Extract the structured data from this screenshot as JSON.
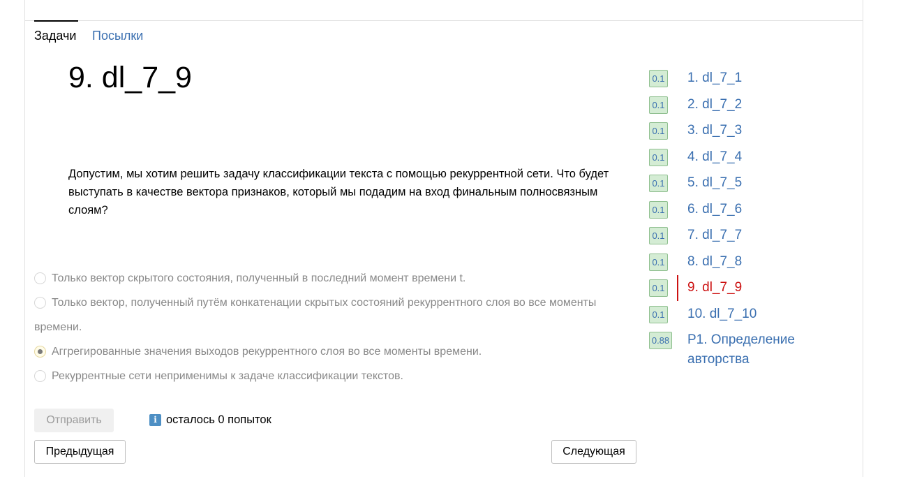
{
  "tabs": {
    "tasks": "Задачи",
    "submissions": "Посылки"
  },
  "task": {
    "title": "9. dl_7_9",
    "statement": "Допустим, мы хотим решить задачу классификации текста с помощью рекуррентной сети. Что будет выступать в качестве вектора признаков, который мы подадим на вход финальным полносвязным слоям?"
  },
  "options": [
    {
      "label": "Только вектор скрытого состояния, полученный в последний момент времени t.",
      "checked": false
    },
    {
      "label": "Только вектор, полученный путём конкатенации скрытых состояний рекуррентного слоя во все моменты",
      "label_cont": "времени.",
      "checked": false
    },
    {
      "label": "Аггрегированные значения выходов рекуррентного слоя во все моменты времени.",
      "checked": true
    },
    {
      "label": "Рекуррентные сети неприменимы к задаче классификации текстов.",
      "checked": false
    }
  ],
  "buttons": {
    "submit": "Отправить",
    "prev": "Предыдущая",
    "next": "Следующая"
  },
  "attempts": {
    "icon": "info-icon",
    "text": "осталось 0 попыток"
  },
  "task_list": [
    {
      "score": "0.1",
      "label": "1. dl_7_1"
    },
    {
      "score": "0.1",
      "label": "2. dl_7_2"
    },
    {
      "score": "0.1",
      "label": "3. dl_7_3"
    },
    {
      "score": "0.1",
      "label": "4. dl_7_4"
    },
    {
      "score": "0.1",
      "label": "5. dl_7_5"
    },
    {
      "score": "0.1",
      "label": "6. dl_7_6"
    },
    {
      "score": "0.1",
      "label": "7. dl_7_7"
    },
    {
      "score": "0.1",
      "label": "8. dl_7_8"
    },
    {
      "score": "0.1",
      "label": "9. dl_7_9",
      "current": true
    },
    {
      "score": "0.1",
      "label": "10. dl_7_10"
    },
    {
      "score": "0.88",
      "label": "P1. Определение авторства"
    }
  ],
  "colors": {
    "link": "#3a6fb0",
    "current": "#cc1111",
    "score_bg": "#d4ecd4"
  }
}
